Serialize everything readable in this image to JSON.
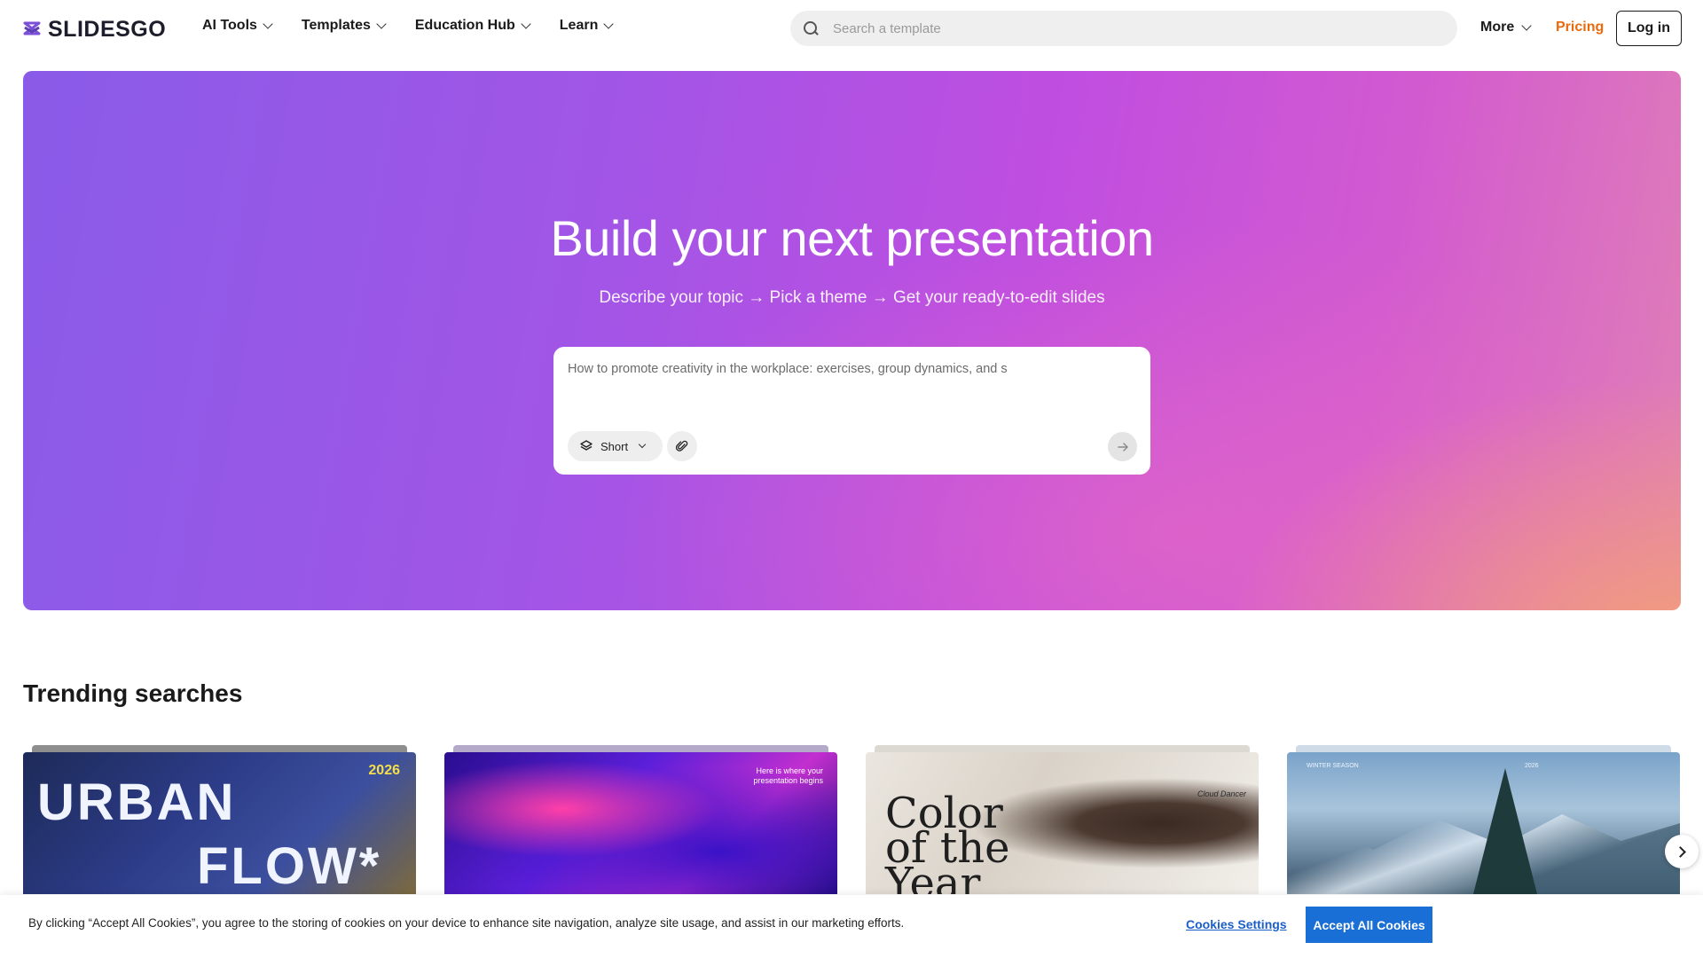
{
  "header": {
    "logo_text": "SLIDESGO",
    "nav": [
      {
        "label": "AI Tools"
      },
      {
        "label": "Templates"
      },
      {
        "label": "Education Hub"
      },
      {
        "label": "Learn"
      }
    ],
    "search_placeholder": "Search a template",
    "more_label": "More",
    "pricing_label": "Pricing",
    "login_label": "Log in",
    "colors": {
      "pricing": "#ea6a0c",
      "logo": "#7b4fd6"
    }
  },
  "hero": {
    "title": "Build your next presentation",
    "subtitle": "Describe your topic → Pick a theme → Get your ready-to-edit slides",
    "prompt_text": "How to promote creativity in the workplace: exercises, group dynamics, and s",
    "length_option": "Short",
    "icons": {
      "length": "layers-icon",
      "attach": "paperclip-icon",
      "send": "arrow-right-icon"
    }
  },
  "trending": {
    "title": "Trending searches",
    "cards": [
      {
        "lines": [
          "URBAN",
          "FLOW*"
        ],
        "badge": "2026"
      },
      {
        "text": "Here is where your presentation begins"
      },
      {
        "lines": [
          "Color",
          "of the",
          "Year"
        ],
        "tag": "Cloud Dancer"
      },
      {
        "tags": [
          "WINTER SEASON",
          "2026"
        ]
      }
    ]
  },
  "cookie": {
    "text": "By clicking “Accept All Cookies”, you agree to the storing of cookies on your device to enhance site navigation, analyze site usage, and assist in our marketing efforts.",
    "settings_label": "Cookies Settings",
    "accept_label": "Accept All Cookies",
    "accent": "#1a6fd6"
  }
}
